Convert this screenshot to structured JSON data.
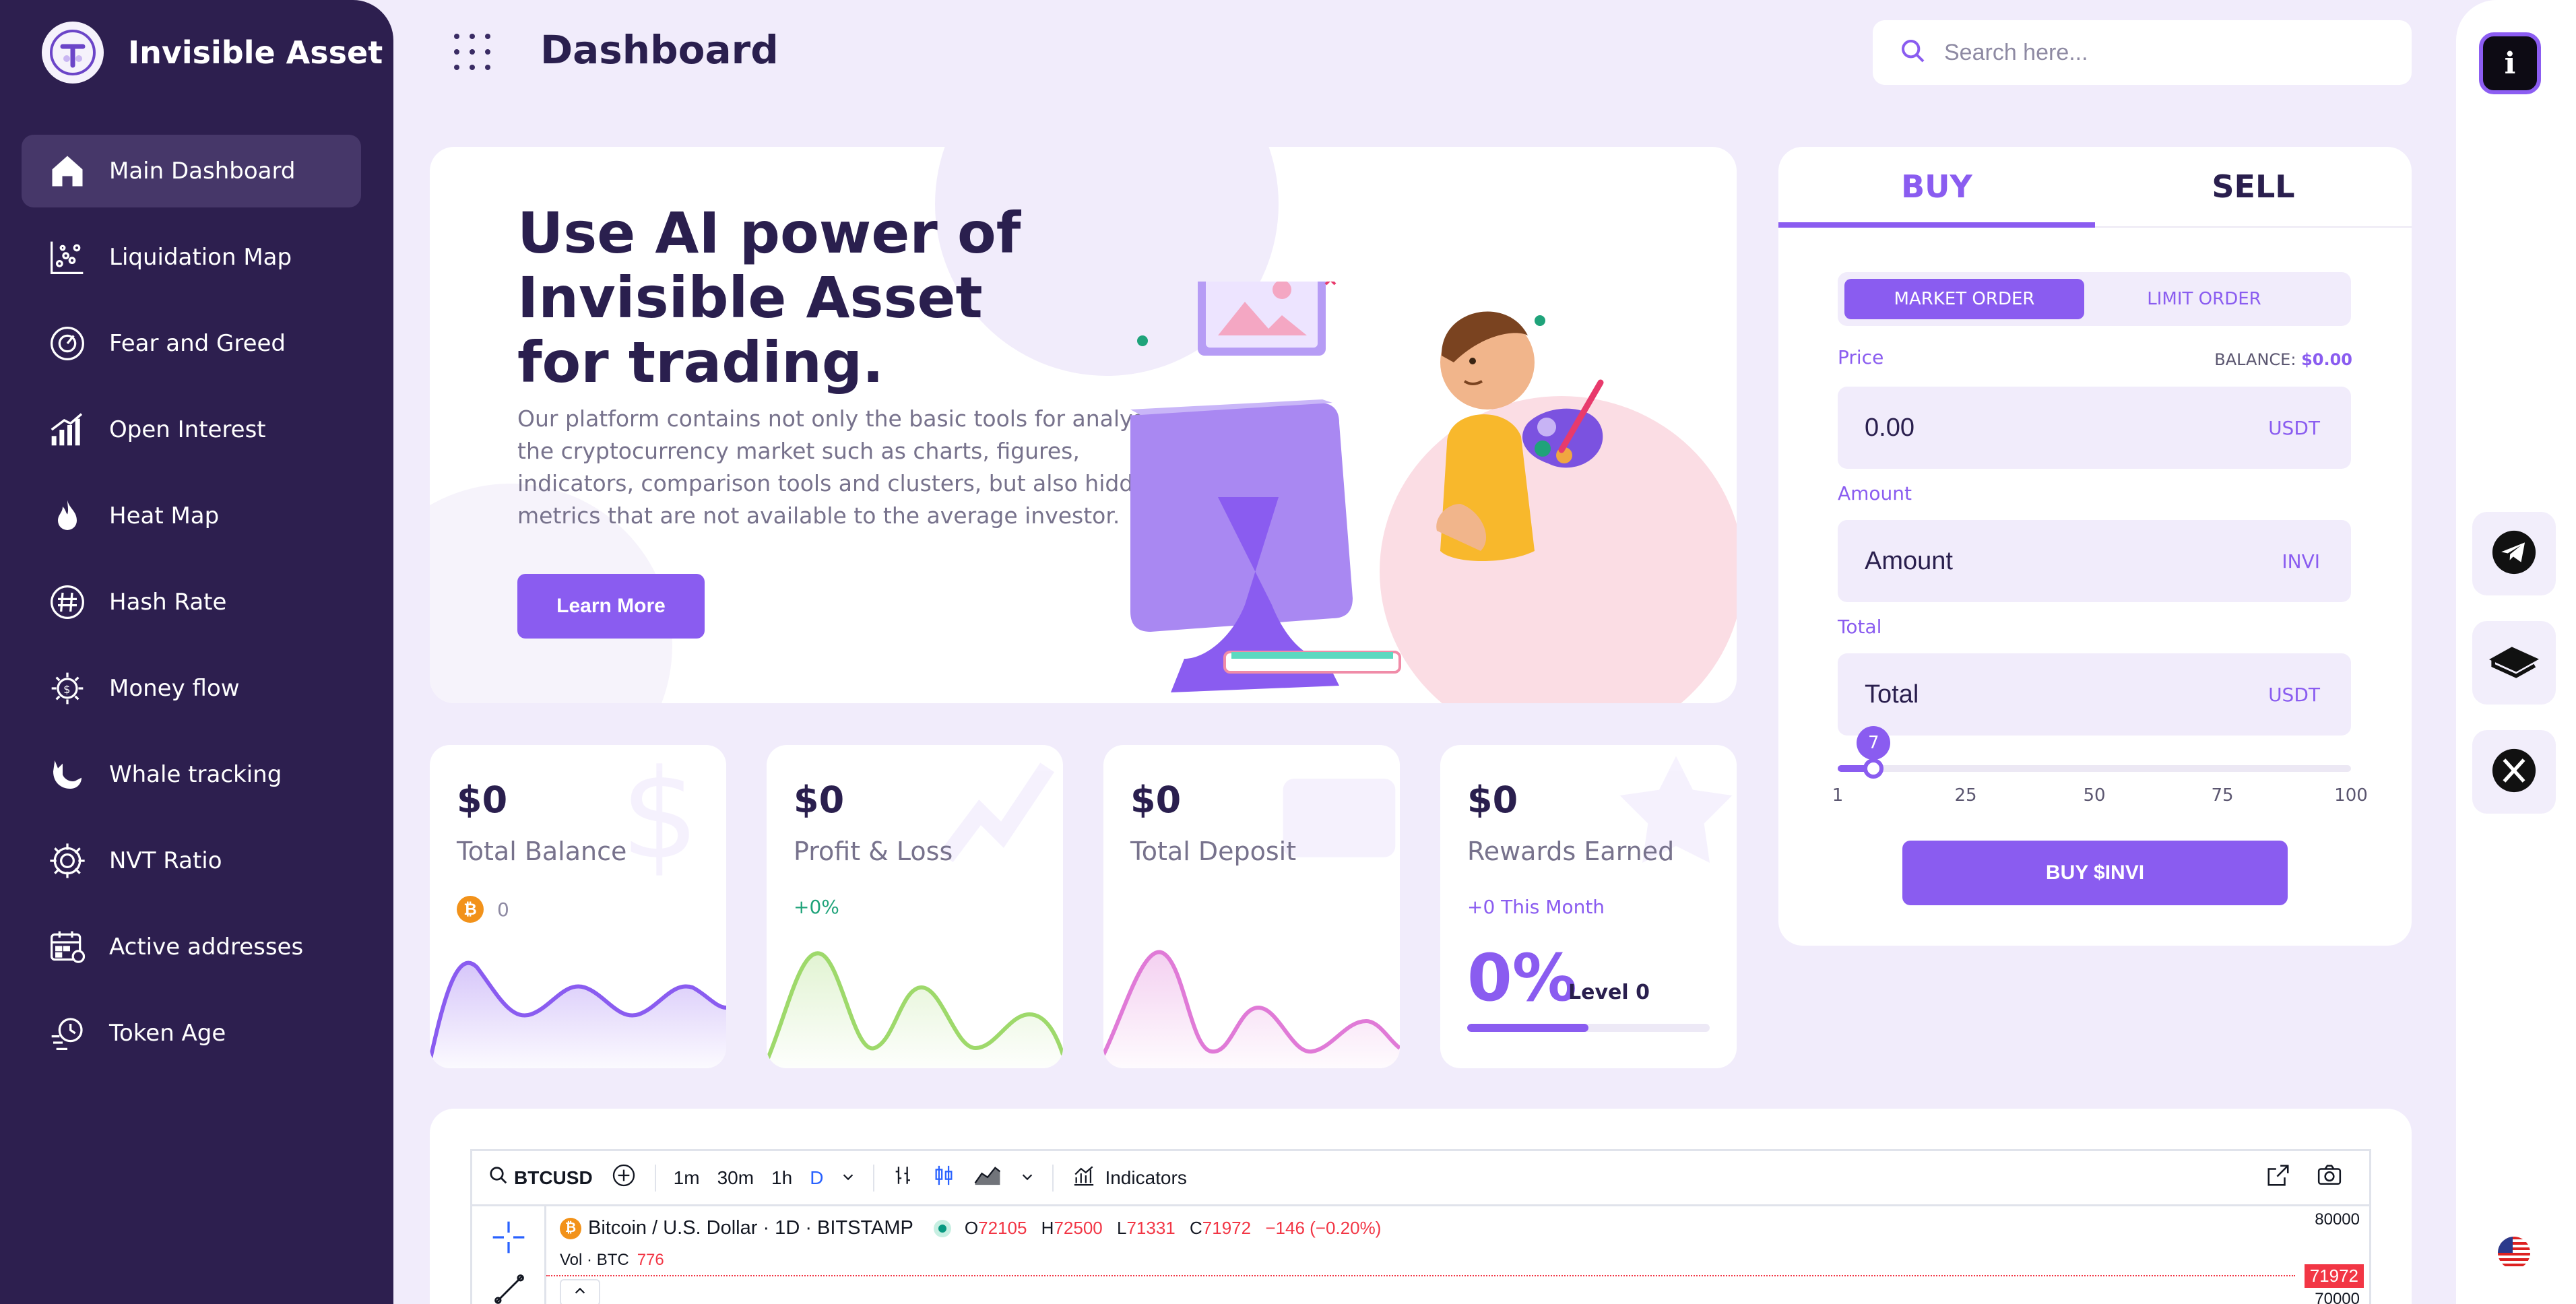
{
  "brand": {
    "name": "Invisible Asset",
    "logo_icon": "brand-logo-icon"
  },
  "sidebar": {
    "items": [
      {
        "label": "Main Dashboard",
        "icon": "home-icon",
        "active": true
      },
      {
        "label": "Liquidation Map",
        "icon": "scatter-chart-icon"
      },
      {
        "label": "Fear and Greed",
        "icon": "gauge-icon"
      },
      {
        "label": "Open Interest",
        "icon": "bar-chart-icon"
      },
      {
        "label": "Heat Map",
        "icon": "flame-icon"
      },
      {
        "label": "Hash Rate",
        "icon": "hash-globe-icon"
      },
      {
        "label": "Money flow",
        "icon": "money-cog-icon"
      },
      {
        "label": "Whale tracking",
        "icon": "whale-icon"
      },
      {
        "label": "NVT Ratio",
        "icon": "settings-icon"
      },
      {
        "label": "Active addresses",
        "icon": "calendar-grid-icon"
      },
      {
        "label": "Token Age",
        "icon": "clock-coin-icon"
      }
    ]
  },
  "header": {
    "title": "Dashboard",
    "search_placeholder": "Search here..."
  },
  "hero": {
    "title": "Use AI power of Invisible Asset for trading.",
    "text": "Our platform contains not only the basic tools for analysing the cryptocurrency market such as charts, figures, indicators, comparison tools and clusters, but also hidden metrics that are not available to the average investor.",
    "button": "Learn More"
  },
  "stats": {
    "balance": {
      "value": "$0",
      "label": "Total Balance",
      "sub": "0",
      "color": "#8a5cf0"
    },
    "pnl": {
      "value": "$0",
      "label": "Profit & Loss",
      "sub": "+0%",
      "color": "#9ed96b"
    },
    "deposit": {
      "value": "$0",
      "label": "Total Deposit",
      "color": "#e07ad7"
    },
    "rewards": {
      "value": "$0",
      "label": "Rewards Earned",
      "sub": "+0 This Month",
      "percent": "0%",
      "level": "Level 0",
      "progress": 0.5
    }
  },
  "trade": {
    "tabs": [
      "BUY",
      "SELL"
    ],
    "active_tab": "BUY",
    "order_types": [
      "MARKET ORDER",
      "LIMIT ORDER"
    ],
    "price": {
      "label": "Price",
      "value": "0.00",
      "unit": "USDT"
    },
    "balance_label": "BALANCE:",
    "balance_value": "$0.00",
    "amount": {
      "label": "Amount",
      "placeholder": "Amount",
      "unit": "INVI"
    },
    "total": {
      "label": "Total",
      "placeholder": "Total",
      "unit": "USDT"
    },
    "slider": {
      "value": "7",
      "fraction": 0.07,
      "ticks": [
        "1",
        "25",
        "50",
        "75",
        "100"
      ]
    },
    "buy_button": "BUY $INVI"
  },
  "tradingview": {
    "symbol": "BTCUSD",
    "intervals": [
      "1m",
      "30m",
      "1h",
      "D"
    ],
    "active_interval": "D",
    "indicators": "Indicators",
    "instrument": "Bitcoin / U.S. Dollar · 1D · BITSTAMP",
    "ohlc": {
      "o": "72105",
      "h": "72500",
      "l": "71331",
      "c": "71972",
      "change": "−146 (−0.20%)"
    },
    "vol_label": "Vol · BTC",
    "vol_value": "776",
    "price_top": "80000",
    "last_price": "71972",
    "price_mid": "70000"
  },
  "colors": {
    "accent": "#8a5cf0",
    "sidebar": "#2d1f4f",
    "background": "#f1ecfb",
    "negative": "#f23645"
  }
}
